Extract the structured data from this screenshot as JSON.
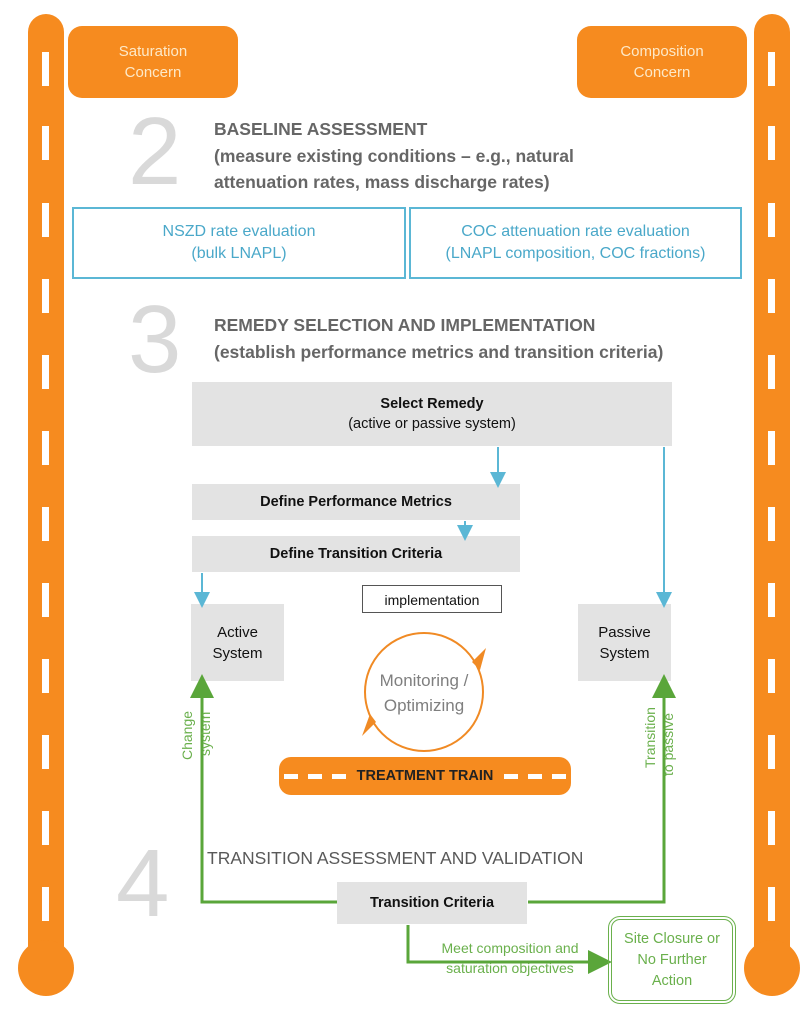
{
  "concerns": {
    "left": [
      "Saturation",
      "Concern"
    ],
    "right": [
      "Composition",
      "Concern"
    ]
  },
  "steps": [
    {
      "number": "2",
      "title": "BASELINE ASSESSMENT",
      "subtitle": [
        "(measure existing conditions – e.g., natural",
        "attenuation rates, mass discharge rates)"
      ]
    },
    {
      "number": "3",
      "title": "REMEDY SELECTION AND IMPLEMENTATION",
      "subtitle": [
        "(establish performance metrics and transition criteria)"
      ]
    },
    {
      "number": "4",
      "title": "TRANSITION ASSESSMENT AND VALIDATION",
      "subtitle": []
    }
  ],
  "baseline_boxes": [
    {
      "line1": "NSZD rate evaluation",
      "line2": "(bulk LNAPL)"
    },
    {
      "line1": "COC attenuation rate evaluation",
      "line2": "(LNAPL composition, COC fractions)"
    }
  ],
  "flow": {
    "select_remedy": {
      "title": "Select Remedy",
      "subtitle": "(active or passive system)"
    },
    "define_metrics": "Define Performance Metrics",
    "define_criteria": "Define Transition Criteria",
    "implementation": "implementation",
    "active_system": [
      "Active",
      "System"
    ],
    "passive_system": [
      "Passive",
      "System"
    ],
    "monitoring": [
      "Monitoring /",
      "Optimizing"
    ],
    "treatment_train": "TREATMENT TRAIN",
    "change_system": [
      "Change",
      "system"
    ],
    "transition_to_passive": [
      "Transition",
      "to passive"
    ],
    "transition_criteria": "Transition Criteria",
    "meet_objectives": [
      "Meet composition and",
      "saturation objectives"
    ],
    "site_closure": [
      "Site Closure or",
      "No Further",
      "Action"
    ]
  },
  "colors": {
    "orange": "#f68b1f",
    "blue": "#5bb7d5",
    "green": "#6ab04c",
    "grey_box": "#e3e3e3",
    "step_number": "#d9d9d9"
  }
}
